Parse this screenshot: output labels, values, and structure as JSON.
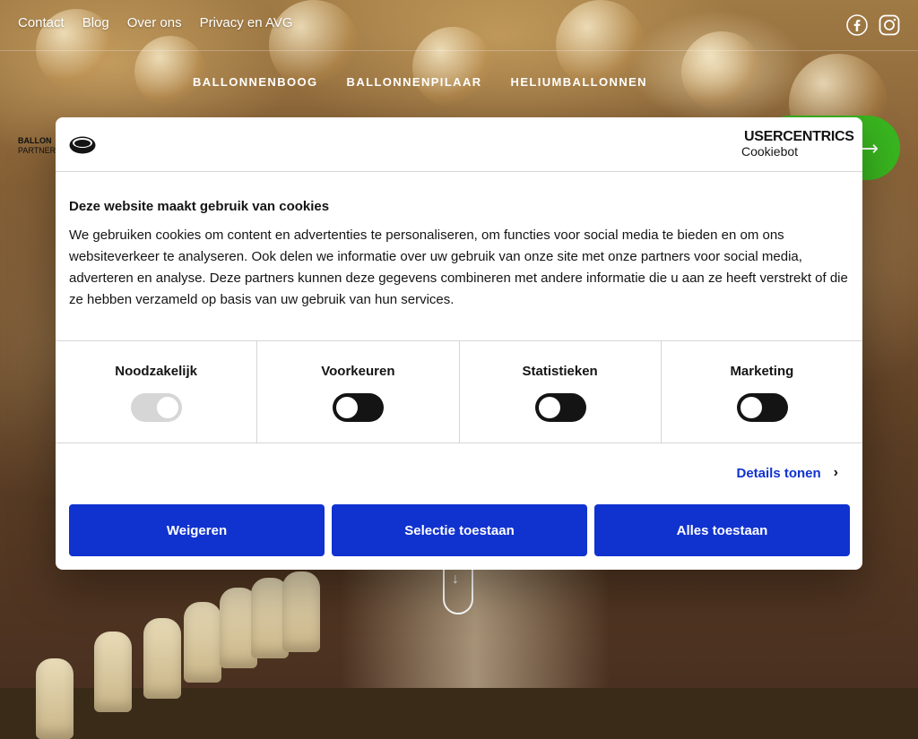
{
  "header": {
    "top_links": [
      "Contact",
      "Blog",
      "Over ons",
      "Privacy en AVG"
    ],
    "social_icons": [
      "facebook-icon",
      "instagram-icon"
    ],
    "main_nav": [
      "BALLONNENBOOG",
      "BALLONNENPILAAR",
      "HELIUMBALLONNEN"
    ],
    "logo_text_1": "BALLON",
    "logo_text_2": "PARTNER"
  },
  "cookie_dialog": {
    "brand_name": "USERCENTRICS",
    "brand_sub": "Cookiebot",
    "title": "Deze website maakt gebruik van cookies",
    "text": "We gebruiken cookies om content en advertenties te personaliseren, om functies voor social media te bieden en om ons websiteverkeer te analyseren. Ook delen we informatie over uw gebruik van onze site met onze partners voor social media, adverteren en analyse. Deze partners kunnen deze gegevens combineren met andere informatie die u aan ze heeft verstrekt of die ze hebben verzameld op basis van uw gebruik van hun services.",
    "categories": [
      {
        "label": "Noodzakelijk",
        "enabled": true,
        "locked": true
      },
      {
        "label": "Voorkeuren",
        "enabled": false,
        "locked": false
      },
      {
        "label": "Statistieken",
        "enabled": false,
        "locked": false
      },
      {
        "label": "Marketing",
        "enabled": false,
        "locked": false
      }
    ],
    "details_link": "Details tonen",
    "buttons": {
      "reject": "Weigeren",
      "selection": "Selectie toestaan",
      "all": "Alles toestaan"
    }
  },
  "colors": {
    "primary_blue": "#1032cf",
    "toggle_dark": "#141414",
    "cta_green": "#39b51f"
  }
}
